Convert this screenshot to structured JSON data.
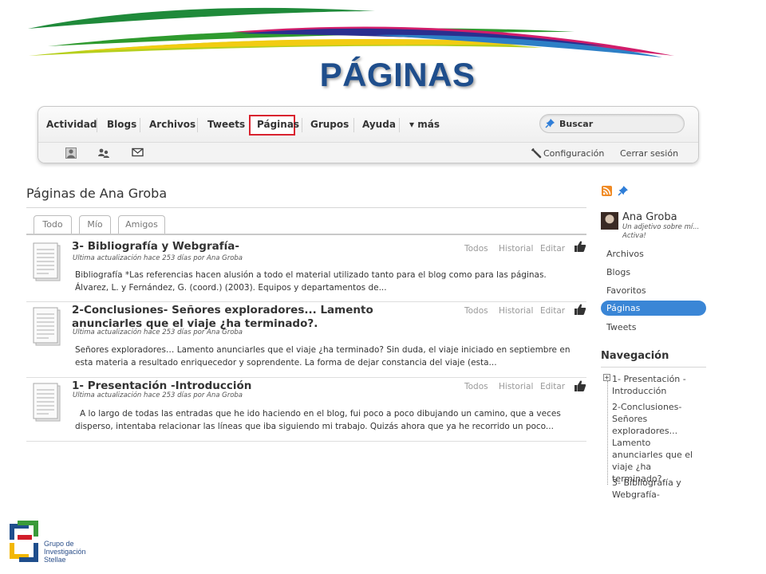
{
  "slide": {
    "title": "PÁGINAS"
  },
  "navbar": {
    "items": [
      "Actividad",
      "Blogs",
      "Archivos",
      "Tweets",
      "Páginas",
      "Grupos",
      "Ayuda"
    ],
    "more_arrow": "▾",
    "more_label": "más",
    "active_item": "Páginas",
    "search_placeholder": "Buscar",
    "config_label": "Configuración",
    "logout_label": "Cerrar sesión"
  },
  "main": {
    "heading": "Páginas de Ana Groba",
    "tabs": [
      "Todo",
      "Mío",
      "Amigos"
    ],
    "actions": [
      "Todos",
      "Historial",
      "Editar"
    ],
    "entries": [
      {
        "title": "3- Bibliografía y Webgrafía-",
        "meta": "Ultima actualización hace 253 días por Ana Groba",
        "excerpt": "Bibliografía *Las referencias hacen alusión a todo el material utilizado tanto para el blog como para las páginas.    Álvarez, L. y Fernández, G. (coord.) (2003). Equipos y departamentos de..."
      },
      {
        "title": "2-Conclusiones- Señores exploradores... Lamento anunciarles que el viaje ¿ha terminado?.",
        "meta": "Ultima actualización hace 253 días por Ana Groba",
        "excerpt": "Señores exploradores… Lamento anunciarles que el viaje ¿ha terminado? Sin duda, el viaje iniciado en septiembre en esta materia a resultado enriquecedor y soprendente. La forma de dejar constancia del viaje (esta..."
      },
      {
        "title": "1- Presentación -Introducción",
        "meta": "Ultima actualización hace 253 días por Ana Groba",
        "excerpt": "A lo largo de todas las entradas que he ido haciendo en el blog, fui poco a poco dibujando un camino, que a veces disperso, intentaba relacionar las líneas que iba siguiendo mi trabajo. Quizás ahora que ya he recorrido un poco..."
      }
    ]
  },
  "sidebar": {
    "user_name": "Ana Groba",
    "user_tagline": "Un adjetivo sobre mí... Activa!",
    "links": [
      "Archivos",
      "Blogs",
      "Favoritos",
      "Páginas",
      "Tweets"
    ],
    "active_link": "Páginas",
    "nav_heading": "Navegación",
    "tree_expander": "+",
    "tree": [
      "1- Presentación -Introducción",
      "2-Conclusiones- Señores exploradores... Lamento anunciarles que el viaje ¿ha terminado?.",
      "3- Bibliografía y Webgrafía-"
    ]
  },
  "footer": {
    "logo_lines": [
      "Grupo de",
      "Investigación",
      "Stellae"
    ]
  },
  "colors": {
    "title_blue": "#1f4e8c",
    "active_red": "#d9232f",
    "sidebar_active": "#3a86d6"
  }
}
